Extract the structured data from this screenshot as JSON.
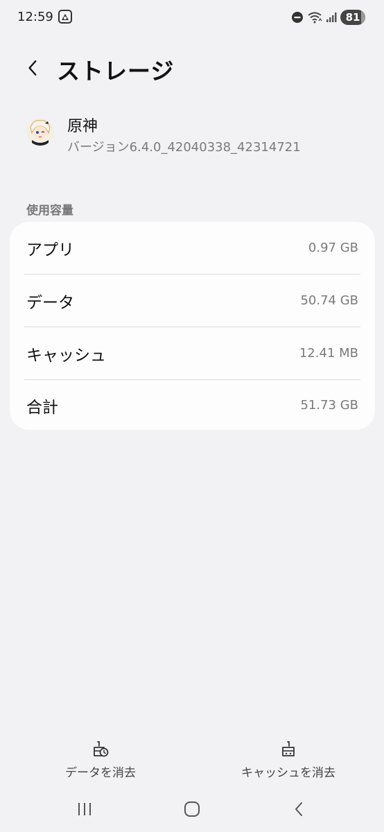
{
  "status_bar": {
    "time": "12:59",
    "battery": "81"
  },
  "header": {
    "title": "ストレージ"
  },
  "app": {
    "name": "原神",
    "version": "バージョン6.4.0_42040338_42314721"
  },
  "usage": {
    "section_title": "使用容量",
    "rows": [
      {
        "label": "アプリ",
        "value": "0.97 GB"
      },
      {
        "label": "データ",
        "value": "50.74 GB"
      },
      {
        "label": "キャッシュ",
        "value": "12.41 MB"
      },
      {
        "label": "合計",
        "value": "51.73 GB"
      }
    ]
  },
  "actions": {
    "clear_data": "データを消去",
    "clear_cache": "キャッシュを消去"
  },
  "icons": {
    "back": "chevron-left-icon",
    "clear_data": "broom-data-icon",
    "clear_cache": "broom-cache-icon",
    "nav_recents": "recents-icon",
    "nav_home": "home-icon",
    "nav_back": "back-icon"
  }
}
